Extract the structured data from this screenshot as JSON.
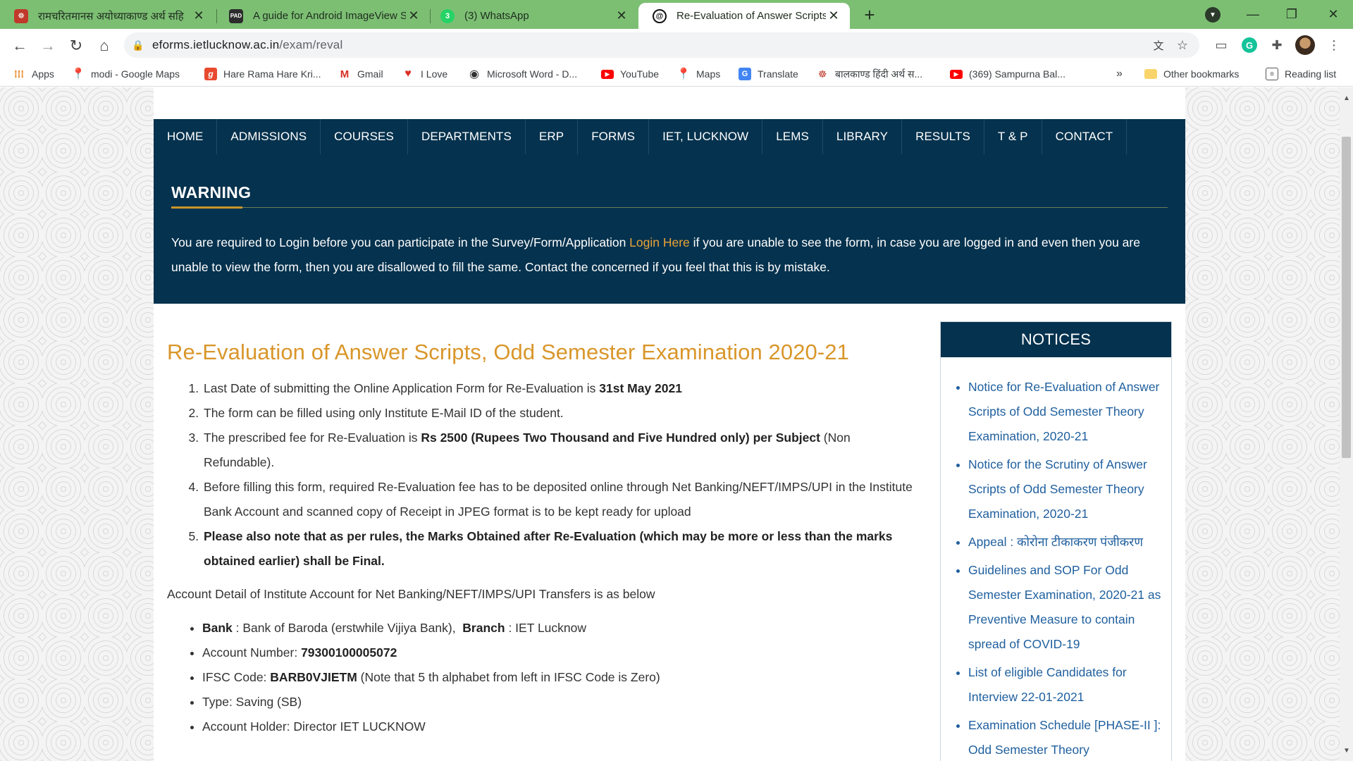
{
  "tabs": [
    {
      "title": "रामचरितमानस अयोध्याकाण्ड अर्थ सहि",
      "icon": "ram-icon",
      "color": "#c0392b",
      "active": false
    },
    {
      "title": "A guide for Android ImageView S",
      "icon": "pad-icon",
      "color": "#2c2c2c",
      "glyph": "PAD",
      "active": false
    },
    {
      "title": "(3) WhatsApp",
      "icon": "whatsapp-icon",
      "color": "#25d366",
      "glyph": "3",
      "active": false
    },
    {
      "title": "Re-Evaluation of Answer Scripts,",
      "icon": "iet-icon",
      "color": "#111111",
      "glyph": "@",
      "active": true
    }
  ],
  "address_bar": {
    "host": "eforms.ietlucknow.ac.in",
    "path": "/exam/reval"
  },
  "bookmarks": [
    {
      "label": "Apps",
      "icon": "apps-grid-icon"
    },
    {
      "label": "modi - Google Maps",
      "icon": "maps-pin-icon"
    },
    {
      "label": "Hare Rama Hare Kri...",
      "icon": "g-letter-icon"
    },
    {
      "label": "Gmail",
      "icon": "gmail-icon"
    },
    {
      "label": "I Love",
      "icon": "heart-icon"
    },
    {
      "label": "Microsoft Word - D...",
      "icon": "globe-icon"
    },
    {
      "label": "YouTube",
      "icon": "youtube-icon"
    },
    {
      "label": "Maps",
      "icon": "maps-pin-icon"
    },
    {
      "label": "Translate",
      "icon": "translate-icon"
    },
    {
      "label": "बालकाण्ड हिंदी अर्थ स...",
      "icon": "ram-icon"
    },
    {
      "label": "(369) Sampurna Bal...",
      "icon": "youtube-icon"
    }
  ],
  "bookmarks_overflow": "»",
  "other_bookmarks": "Other bookmarks",
  "reading_list": "Reading list",
  "nav": [
    "HOME",
    "ADMISSIONS",
    "COURSES",
    "DEPARTMENTS",
    "ERP",
    "FORMS",
    "IET, LUCKNOW",
    "LEMS",
    "LIBRARY",
    "RESULTS",
    "T & P",
    "CONTACT"
  ],
  "warning": {
    "title": "WARNING",
    "text_before": "You are required to Login before you can participate in the Survey/Form/Application ",
    "link": "Login Here",
    "text_after": " if you are unable to see the form, in case you are logged in and even then you are unable to view the form, then you are disallowed to fill the same. Contact the concerned if you feel that this is by mistake."
  },
  "heading": "Re-Evaluation of Answer Scripts, Odd Semester Examination 2020-21",
  "rules": {
    "r1_text": "Last Date of submitting the Online Application Form for Re-Evaluation is ",
    "r1_bold": "31st May 2021",
    "r2": "The form can be filled using only Institute E-Mail ID of the student.",
    "r3_text": "The prescribed fee for Re-Evaluation is ",
    "r3_bold": "Rs 2500 (Rupees Two Thousand and Five Hundred only) per Subject",
    "r3_after": " (Non Refundable).",
    "r4": "Before filling this form, required Re-Evaluation fee has to be deposited online through Net Banking/NEFT/IMPS/UPI in the Institute Bank Account and scanned copy of Receipt in JPEG format is to be kept ready for upload",
    "r5": "Please also note that as per rules, the Marks Obtained after Re-Evaluation (which may be more or less than the marks obtained earlier) shall be Final."
  },
  "account_intro": "Account Detail of Institute Account for Net Banking/NEFT/IMPS/UPI Transfers is as below",
  "account": {
    "bank_label": "Bank",
    "bank_value": " : Bank of Baroda (erstwhile Vijiya Bank),  ",
    "branch_label": "Branch",
    "branch_value": " : IET Lucknow",
    "acno_label": "Account Number: ",
    "acno_value": "79300100005072",
    "ifsc_label": "IFSC Code: ",
    "ifsc_value": "BARB0VJIETM",
    "ifsc_note": " (Note that 5 th alphabet from left in IFSC Code is Zero)",
    "type": "Type: Saving (SB)",
    "holder": "Account Holder: Director IET LUCKNOW"
  },
  "notices": {
    "title": "NOTICES",
    "items": [
      "Notice for Re-Evaluation of Answer Scripts of Odd Semester Theory Examination, 2020-21",
      "Notice for the Scrutiny of Answer Scripts of Odd Semester Theory Examination, 2020-21",
      "Appeal : कोरोना टीकाकरण पंजीकरण",
      "Guidelines and SOP For Odd Semester Examination, 2020-21 as Preventive Measure to contain spread of COVID-19",
      "List of eligible Candidates for Interview 22-01-2021",
      "Examination Schedule [PHASE-II ]: Odd Semester Theory Examination,"
    ]
  },
  "colors": {
    "tab_strip": "#7cbf73",
    "navy": "#05324e",
    "heading_orange": "#d9962a",
    "link_blue": "#1f5f9e",
    "login_link": "#e9a338"
  }
}
